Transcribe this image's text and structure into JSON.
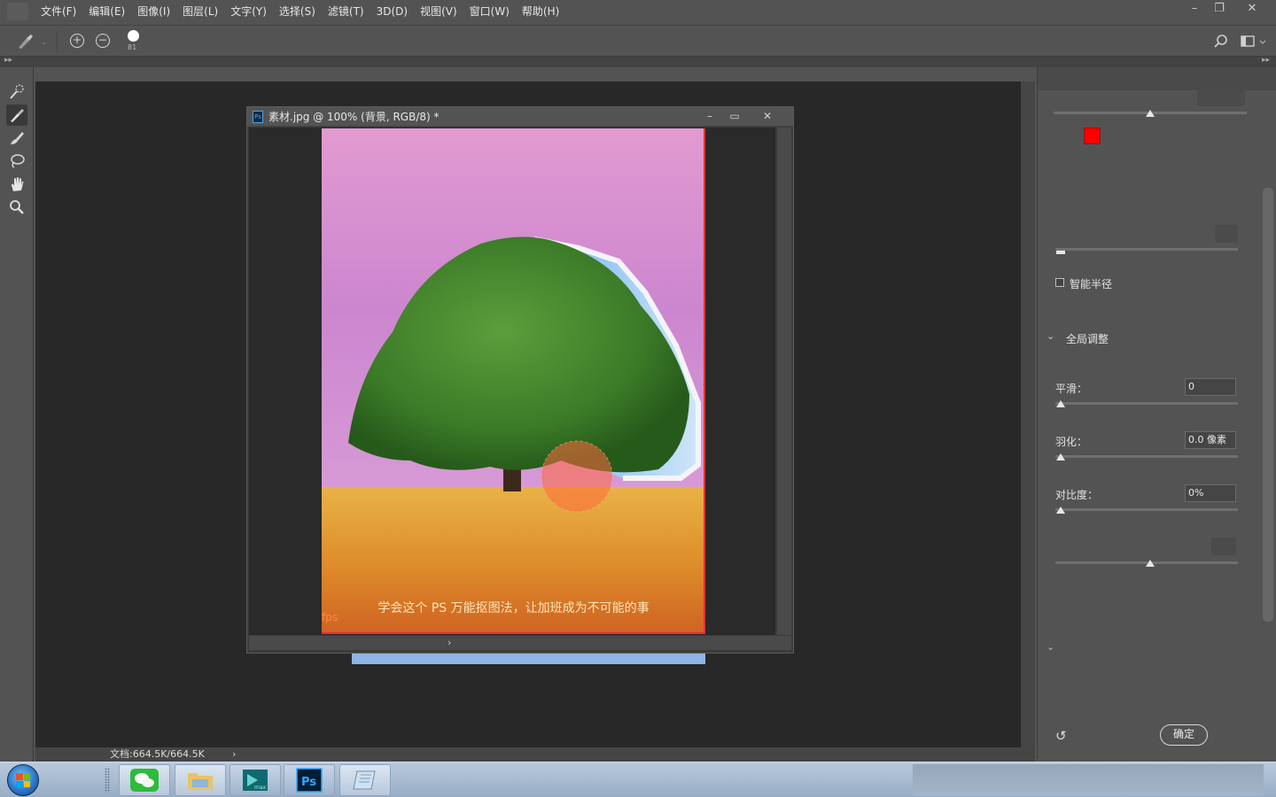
{
  "menubar": {
    "items": [
      "文件(F)",
      "编辑(E)",
      "图像(I)",
      "图层(L)",
      "文字(Y)",
      "选择(S)",
      "滤镜(T)",
      "3D(D)",
      "视图(V)",
      "窗口(W)",
      "帮助(H)"
    ],
    "window_controls": [
      "–",
      "❐",
      "✕"
    ]
  },
  "options": {
    "brush_size": "81"
  },
  "document": {
    "title": "素材.jpg @ 100% (背景, RGB/8) *",
    "controls": [
      "–",
      "▭",
      "✕"
    ],
    "caption": "学会这个 PS 万能抠图法，让加班成为不可能的事",
    "watermark": "fps"
  },
  "panel": {
    "smart_radius_label": "智能半径",
    "section_global": "全局调整",
    "smooth_label": "平滑：",
    "smooth_value": "0",
    "feather_label": "羽化：",
    "feather_value": "0.0 像素",
    "contrast_label": "对比度：",
    "contrast_value": "0%",
    "ok_label": "确定",
    "smart_radius_checked": false,
    "color": "#ff0000"
  },
  "status": {
    "doc_info": "文档:664.5K/664.5K"
  },
  "taskbar": {
    "apps": [
      "wechat",
      "file-explorer",
      "3ds-max",
      "photoshop",
      "notepad"
    ]
  }
}
